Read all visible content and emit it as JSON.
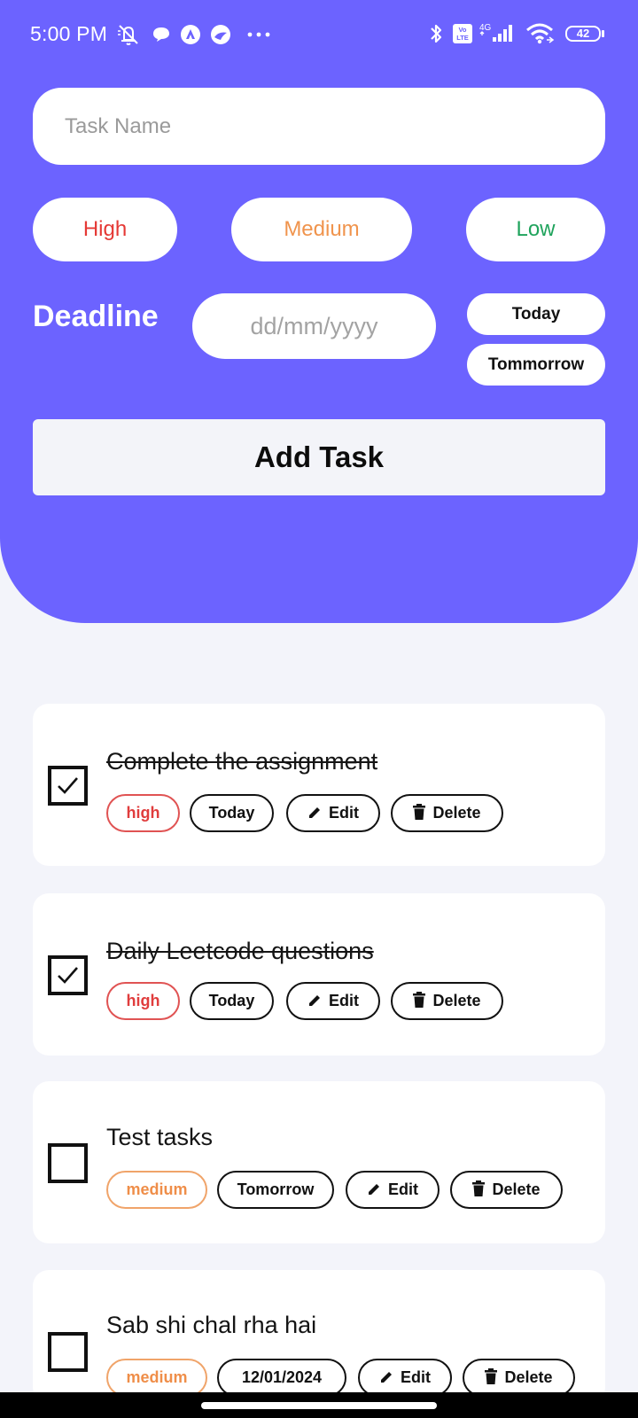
{
  "status_bar": {
    "time": "5:00 PM",
    "battery": "42",
    "icons": [
      "mute-icon",
      "chat-icon",
      "app-icon",
      "app-icon",
      "more-icon",
      "bluetooth-icon",
      "volte-icon",
      "signal-icon",
      "wifi-icon",
      "battery-icon"
    ]
  },
  "form": {
    "task_name_placeholder": "Task Name",
    "priorities": {
      "high": "High",
      "medium": "Medium",
      "low": "Low"
    },
    "deadline_label": "Deadline",
    "date_placeholder": "dd/mm/yyyy",
    "today_label": "Today",
    "tomorrow_label": "Tommorrow",
    "add_task_label": "Add Task"
  },
  "tasks": [
    {
      "title": "Complete the assignment",
      "done": true,
      "priority": "high",
      "deadline": "Today",
      "edit": "Edit",
      "delete": "Delete"
    },
    {
      "title": "Daily Leetcode questions",
      "done": true,
      "priority": "high",
      "deadline": "Today",
      "edit": "Edit",
      "delete": "Delete"
    },
    {
      "title": "Test tasks",
      "done": false,
      "priority": "medium",
      "deadline": "Tomorrow",
      "edit": "Edit",
      "delete": "Delete"
    },
    {
      "title": "Sab shi chal rha hai",
      "done": false,
      "priority": "medium",
      "deadline": "12/01/2024",
      "edit": "Edit",
      "delete": "Delete"
    }
  ],
  "colors": {
    "accent": "#6c63ff",
    "background": "#f3f4fa",
    "high": "#e53935",
    "medium": "#f0944d",
    "low": "#1fa35c"
  }
}
